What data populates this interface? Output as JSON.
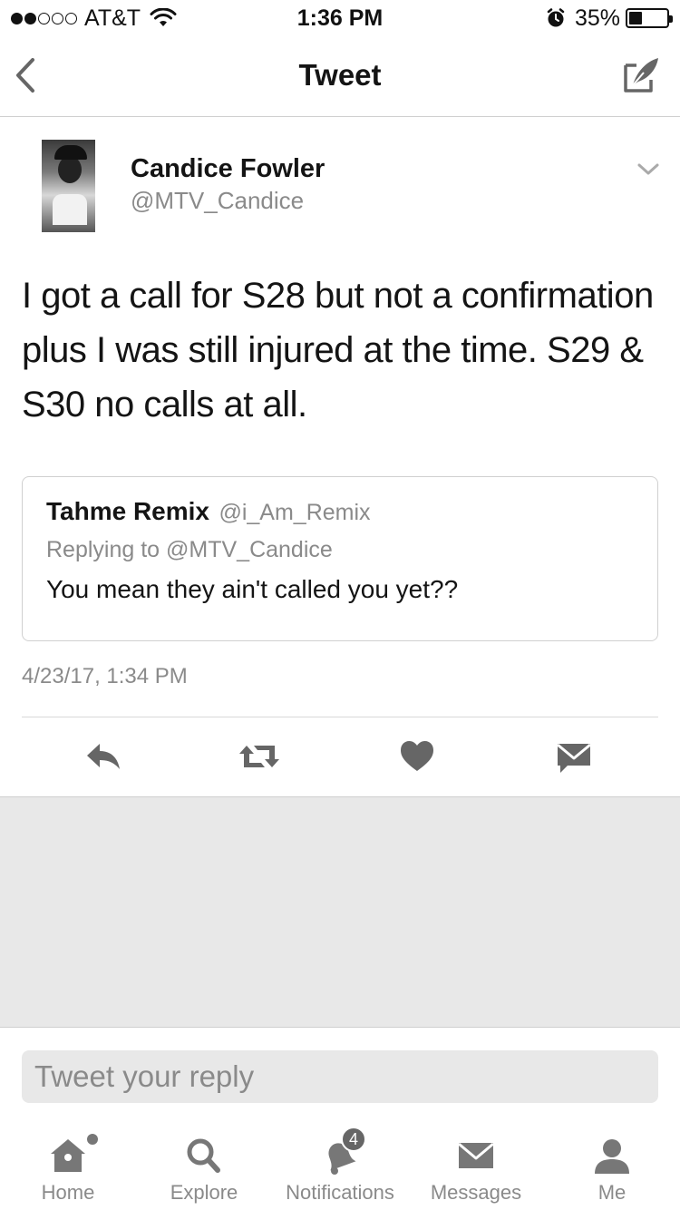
{
  "status_bar": {
    "carrier": "AT&T",
    "time": "1:36 PM",
    "battery_percent": "35%",
    "battery_level": 0.35,
    "signal_bars_filled": 2,
    "signal_bars_total": 5
  },
  "nav": {
    "title": "Tweet"
  },
  "tweet": {
    "author_name": "Candice Fowler",
    "author_handle": "@MTV_Candice",
    "text": "I got a call for S28 but not a confirmation plus I was still injured at the time. S29 & S30 no calls at all.",
    "timestamp": "4/23/17, 1:34 PM"
  },
  "quoted_tweet": {
    "author_name": "Tahme Remix",
    "author_handle": "@i_Am_Remix",
    "replying_to": "Replying to @MTV_Candice",
    "text": "You mean they ain't called you yet??"
  },
  "actions": [
    {
      "name": "reply",
      "icon": "reply-icon"
    },
    {
      "name": "retweet",
      "icon": "retweet-icon"
    },
    {
      "name": "like",
      "icon": "heart-icon"
    },
    {
      "name": "direct-message",
      "icon": "envelope-icon"
    }
  ],
  "reply_box": {
    "placeholder": "Tweet your reply"
  },
  "tab_bar": {
    "home": "Home",
    "explore": "Explore",
    "notifications": "Notifications",
    "notifications_badge": "4",
    "messages": "Messages",
    "me": "Me"
  },
  "colors": {
    "text_primary": "#141414",
    "text_secondary": "#8a8a8a",
    "icon": "#666666",
    "divider": "#d0d0d0",
    "empty_area": "#e8e8e8"
  }
}
